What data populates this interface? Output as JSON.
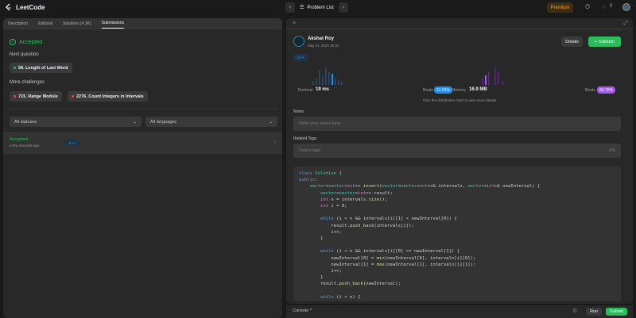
{
  "app": {
    "name": "LeetCode"
  },
  "nav": {
    "problem_list": "Problem List",
    "premium": "Premium",
    "coins": "0"
  },
  "left": {
    "tabs": [
      {
        "label": "Description"
      },
      {
        "label": "Editorial"
      },
      {
        "label": "Solutions (4.3K)"
      },
      {
        "label": "Submissions"
      }
    ],
    "status": "Accepted",
    "next_question_label": "Next question",
    "next_question": "58. Length of Last Word",
    "more_challenges_label": "More challenges",
    "challenges": [
      {
        "title": "715. Range Module",
        "color": "#ef4743"
      },
      {
        "title": "2276. Count Integers in Intervals",
        "color": "#ef4743"
      }
    ],
    "filters": {
      "status": "All statuses",
      "language": "All languages"
    },
    "submission": {
      "status": "Accepted",
      "time": "a few seconds ago",
      "lang": "C++"
    }
  },
  "right": {
    "user": {
      "name": "Akshat Roy",
      "date": "May 11, 2023 20:02"
    },
    "details_label": "Details",
    "solution_label": "Solution",
    "lang": "C++",
    "runtime": {
      "label": "Runtime",
      "value": "19 ms",
      "beats_label": "Beats",
      "beats": "51.91%"
    },
    "memory": {
      "label": "Memory",
      "value": "16.9 MB",
      "beats_label": "Beats",
      "beats": "80.70%"
    },
    "chart_hint": "Click the distribution chart to view more details",
    "notes_label": "Notes",
    "notes_placeholder": "Write your notes here",
    "tags_label": "Related Tags",
    "tags_placeholder": "Select tags",
    "tags_count": "0/5"
  },
  "bottom": {
    "console": "Console",
    "run": "Run",
    "submit": "Submit"
  },
  "colors": {
    "accent_green": "#2cbb5d",
    "runtime_blue": "#1a90ff",
    "memory_purple": "#a855f7",
    "premium_orange": "#ffa116"
  }
}
